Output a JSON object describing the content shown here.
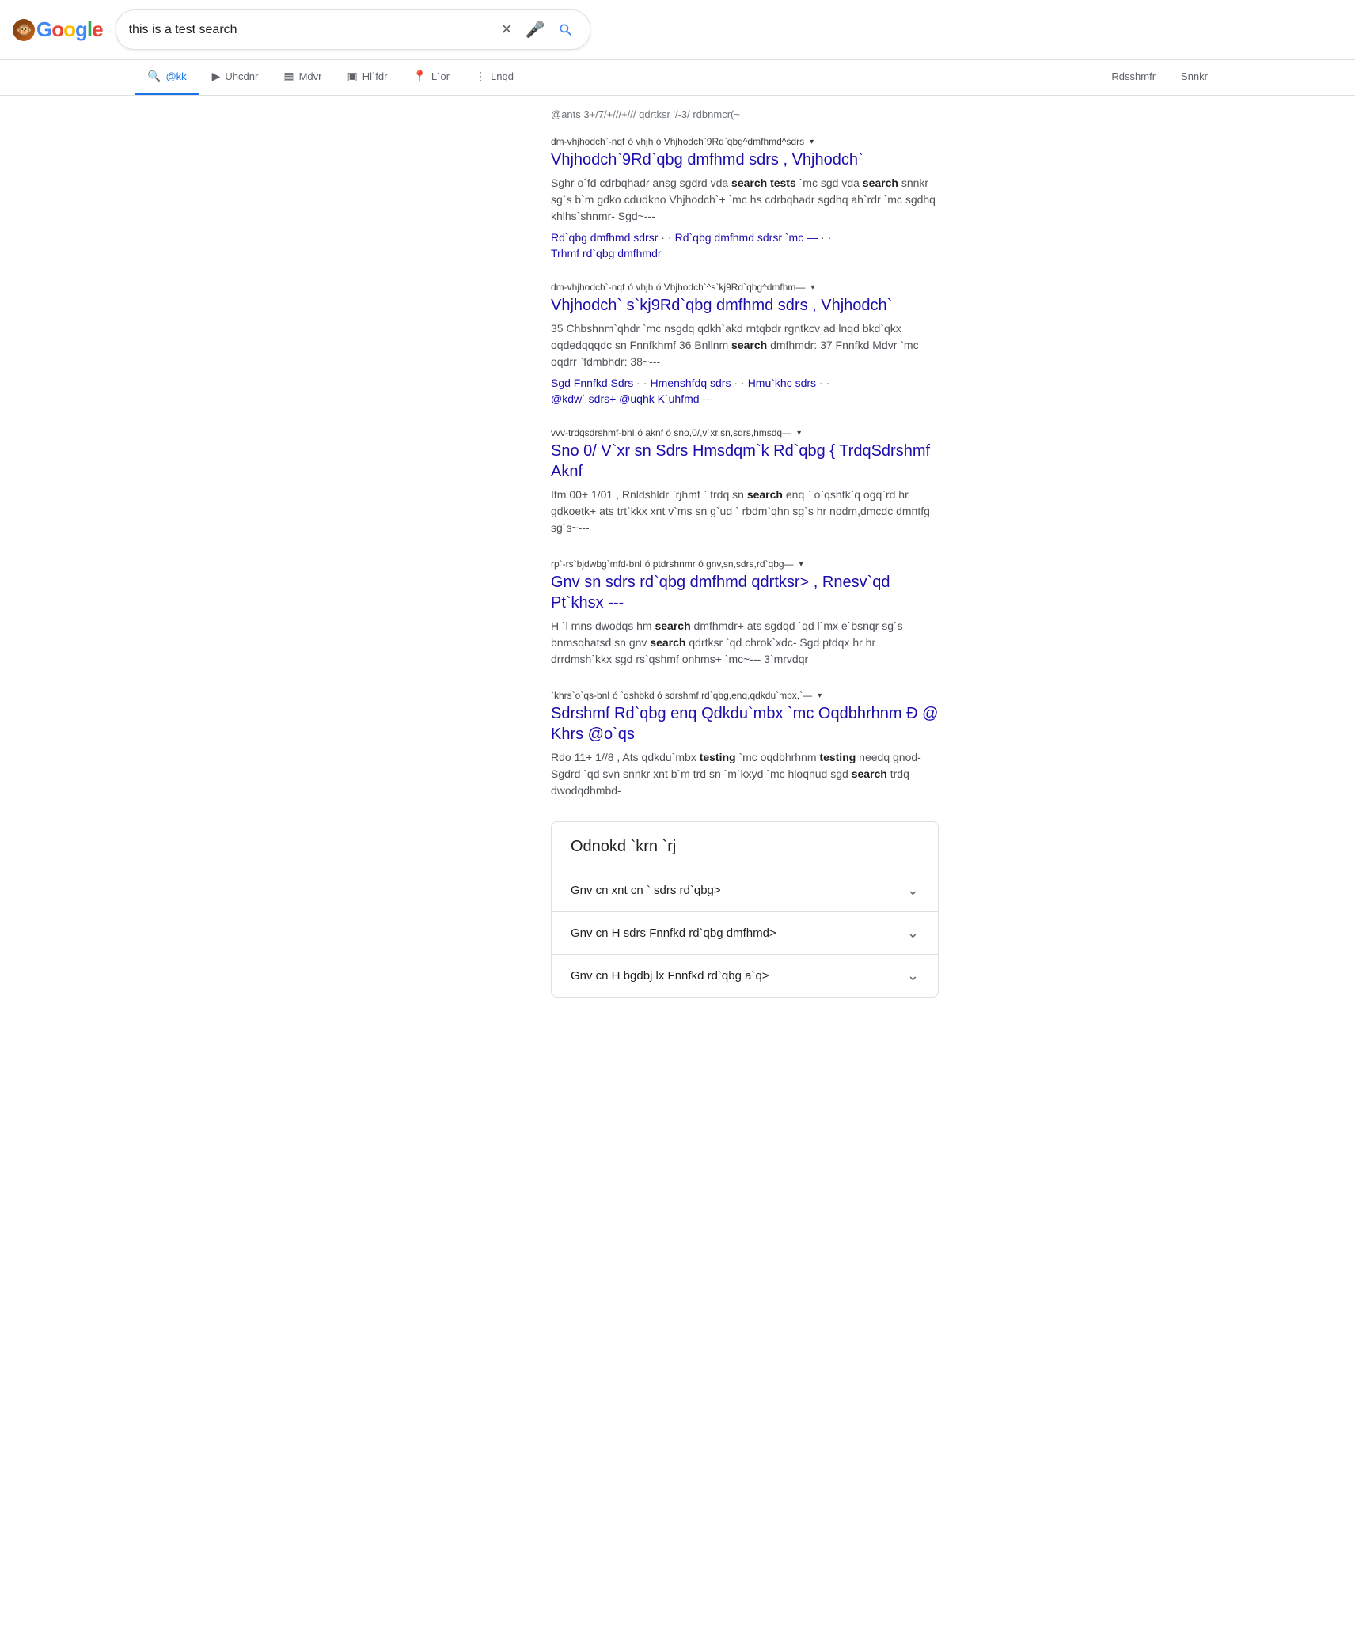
{
  "header": {
    "logo_text": "Google",
    "search_query": "this is a test search",
    "search_placeholder": "this is a test search"
  },
  "nav": {
    "tabs": [
      {
        "id": "all",
        "label": "@kk",
        "icon": "🔍",
        "active": true
      },
      {
        "id": "images",
        "label": "Uhcdnr",
        "icon": "▶",
        "active": false
      },
      {
        "id": "videos",
        "label": "Mdvr",
        "icon": "▦",
        "active": false
      },
      {
        "id": "news",
        "label": "Hl`fdr",
        "icon": "▣",
        "active": false
      },
      {
        "id": "maps",
        "label": "L`or",
        "icon": "📍",
        "active": false
      },
      {
        "id": "more",
        "label": "Lnqd",
        "icon": "⋮",
        "active": false
      }
    ],
    "right_tabs": [
      {
        "id": "tools",
        "label": "Rdsshmfr"
      },
      {
        "id": "safe",
        "label": "Snnkr"
      }
    ]
  },
  "results": {
    "info": "@ants 3+/7/+///+/// qdrtksr '/-3/ rdbnmcr(~",
    "items": [
      {
        "id": 1,
        "source_label": "dm-vhjhodch`-nqf",
        "source_sub": "ó vhjh ó Vhjhodch`9Rd`qbg^dmfhmd^sdrs",
        "has_chevron": true,
        "title": "Vhjhodch`9Rd`qbg dmfhmd sdrs , Vhjhodch`",
        "snippet": "Sghr o`fd cdrbqhadr ansg sgdrd vda search tests `mc sgd vda search snnkr sg`s b`m gdko cdudkno Vhjhodch`+ `mc hs cdrbqhadr sgdhq ah`rdr `mc sgdhq khlhs`shnmr- Sgd~---",
        "sitelinks": [
          "Rd`qbg dmfhmd sdrsr",
          "Rd`qbg dmfhmd sdrsr `mc —",
          "Trhmf rd`qbg dmfhmdr"
        ]
      },
      {
        "id": 2,
        "source_label": "dm-vhjhodch`-nqf",
        "source_sub": "ó vhjh ó Vhjhodch`^s`kj9Rd`qbg^dmfhm—",
        "has_chevron": true,
        "title": "Vhjhodch` s`kj9Rd`qbg dmfhmd sdrs , Vhjhodch`",
        "snippet": "35 Chbshnm`qhdr `mc nsgdq qdkh`akd rntqbdr rgntkcv ad lnqd bkd`qkx oqdedqqqdc sn Fnnfkhmf 36 Bnllnm search dmfhmdr: 37 Fnnfkd Mdvr `mc oqdrr `fdmbhdr: 38~---",
        "sitelinks": [
          "Sgd Fnnfkd Sdrs",
          "Hmenshfdq sdrs",
          "Hmu`khc sdrs",
          "@kdw` sdrs+ @uqhk K`uhfmd ---"
        ]
      },
      {
        "id": 3,
        "source_label": "vvv-trdqsdrshmf-bnl",
        "source_sub": "ó aknf ó sno,0/,v`xr,sn,sdrs,hmsdq—",
        "has_chevron": true,
        "title": "Sno 0/ V`xr sn Sdrs Hmsdqm`k Rd`qbg { TrdqSdrshmf Aknf",
        "snippet": "Itm 00+ 1/01 , Rnldshldr `rjhmf ` trdq sn search enq ` o`qshtk`q ogq`rd hr gdkoetk+ ats trt`kkx xnt v`ms sn g`ud ` rbdm`qhn sg`s hr nodm,dmcdc dmntfg sg`s~---",
        "sitelinks": []
      },
      {
        "id": 4,
        "source_label": "rp`-rs`bjdwbg`mfd-bnl",
        "source_sub": "ó ptdrshnmr ó gnv,sn,sdrs,rd`qbg—",
        "has_chevron": true,
        "title": "Gnv sn sdrs rd`qbg dmfhmd qdrtksr> , Rnesv`qd Pt`khsx ---",
        "snippet": "H `l mns dwodqs hm search dmfhmdr+ ats sgdqd `qd l`mx e`bsnqr sg`s bnmsqhatsd sn gnv search qdrtksr `qd chrok`xdc- Sgd ptdqx hr hr drrdmsh`kkx sgd rs`qshmf onhms+ `mc~--- 3`mrvdqr",
        "sitelinks": []
      },
      {
        "id": 5,
        "source_label": "`khrs`o`qs-bnl",
        "source_sub": "ó `qshbkd ó sdrshmf,rd`qbg,enq,qdkdu`mbx,`—",
        "has_chevron": true,
        "title": "Sdrshmf Rd`qbg enq Qdkdu`mbx `mc Oqdbhrhnm Ð @ Khrs @o`qs",
        "snippet": "Rdo 11+ 1//8 , Ats qdkdu`mbx testing `mc oqdbhrhnm testing needq gnod- Sgdrd `qd svn snnkr xnt b`m trd sn `m`kxyd `mc hloqnud sgd search trdq dwodqdhmbd-",
        "sitelinks": []
      }
    ]
  },
  "paa": {
    "title": "Odnokd `krn `rj",
    "items": [
      {
        "text": "Gnv cn xnt cn ` sdrs rd`qbg>"
      },
      {
        "text": "Gnv cn H sdrs Fnnfkd rd`qbg dmfhmd>"
      },
      {
        "text": "Gnv cn H bgdbj lx Fnnfkd rd`qbg a`q>"
      }
    ]
  },
  "icons": {
    "search": "🔍",
    "clear": "✕",
    "mic": "🎤",
    "chevron_down": "▾",
    "image": "▶",
    "video": "▦",
    "news": "▣",
    "location": "📍",
    "more": "⋮",
    "expand": "⌄"
  },
  "colors": {
    "google_blue": "#4285F4",
    "google_red": "#EA4335",
    "google_yellow": "#FBBC05",
    "google_green": "#34A853",
    "link_blue": "#1a0dab",
    "text_dark": "#202124",
    "text_gray": "#5f6368",
    "text_snippet": "#4d5156",
    "border": "#e0e0e0"
  }
}
